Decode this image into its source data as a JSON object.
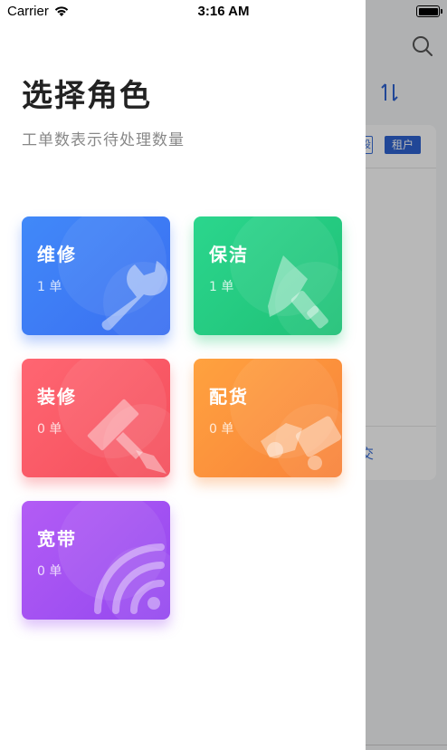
{
  "status_bar": {
    "carrier": "Carrier",
    "time": "3:16 AM"
  },
  "drawer": {
    "title": "选择角色",
    "subtitle": "工单数表示待处理数量",
    "roles": [
      {
        "name": "维修",
        "count": "1 单",
        "icon": "wrench-icon",
        "color": "#3f7ef6"
      },
      {
        "name": "保洁",
        "count": "1 单",
        "icon": "brush-icon",
        "color": "#24cc82"
      },
      {
        "name": "装修",
        "count": "0 单",
        "icon": "paint-brush-icon",
        "color": "#f85a66"
      },
      {
        "name": "配货",
        "count": "0 单",
        "icon": "delivery-icon",
        "color": "#fb923c"
      },
      {
        "name": "宽带",
        "count": "0 单",
        "icon": "wifi-icon",
        "color": "#a552f2"
      }
    ]
  },
  "background": {
    "tag_label": "租户",
    "tag_outline_label": "设",
    "link_fragment": "交"
  }
}
